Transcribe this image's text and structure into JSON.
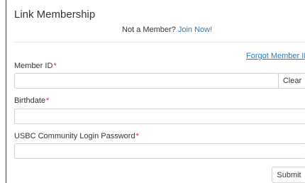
{
  "form": {
    "title": "Link Membership",
    "not_member_text": "Not a Member?",
    "join_link": "Join Now!",
    "forgot_link": "Forgot Member ID?",
    "member_id": {
      "label": "Member ID",
      "required_mark": "*",
      "value": "",
      "placeholder": ""
    },
    "clear_label": "Clear",
    "birthdate": {
      "label": "Birthdate",
      "required_mark": "*",
      "value": "",
      "placeholder": ""
    },
    "password": {
      "label": "USBC Community Login Password",
      "required_mark": "*",
      "value": "",
      "placeholder": ""
    },
    "submit_label": "Submit"
  },
  "colors": {
    "link": "#2a7bb8",
    "required": "#c9302c",
    "text": "#333333",
    "border": "#cfcfcf"
  }
}
